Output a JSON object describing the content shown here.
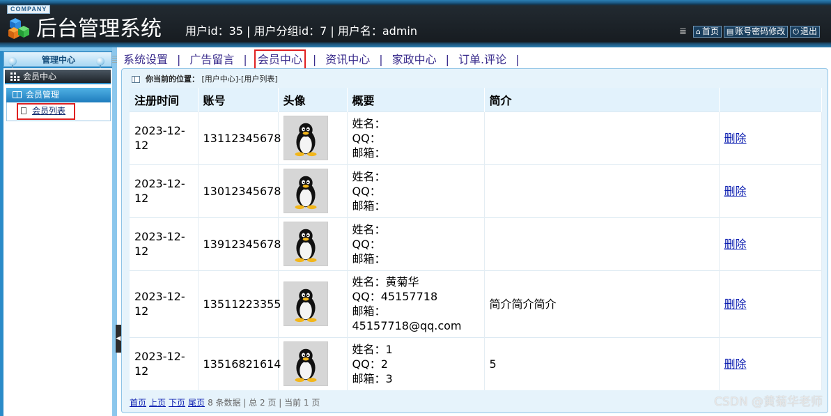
{
  "header": {
    "company": "COMPANY",
    "system_title": "后台管理系统",
    "user_info": "用户id：35 | 用户分组id：7 | 用户名：admin",
    "links": [
      {
        "icon": "home-icon",
        "label": "首页"
      },
      {
        "icon": "document-icon",
        "label": "账号密码修改"
      },
      {
        "icon": "power-icon",
        "label": "退出"
      }
    ]
  },
  "sidebar": {
    "title": "管理中心",
    "section": "会员中心",
    "group": "会员管理",
    "item": "会员列表"
  },
  "topnav": {
    "items": [
      "系统设置",
      "广告留言",
      "会员中心",
      "资讯中心",
      "家政中心",
      "订单.评论"
    ],
    "active_index": 2
  },
  "location": {
    "label": "你当前的位置：",
    "path": "[用户中心]-[用户列表]"
  },
  "table": {
    "headers": [
      "注册时间",
      "账号",
      "头像",
      "概要",
      "简介",
      ""
    ],
    "summary_labels": {
      "name": "姓名：",
      "qq": "QQ：",
      "email": "邮箱："
    },
    "delete_label": "删除",
    "rows": [
      {
        "date": "2023-12-12",
        "account": "13112345678",
        "name": "",
        "qq": "",
        "email": "",
        "intro": ""
      },
      {
        "date": "2023-12-12",
        "account": "13012345678",
        "name": "",
        "qq": "",
        "email": "",
        "intro": ""
      },
      {
        "date": "2023-12-12",
        "account": "13912345678",
        "name": "",
        "qq": "",
        "email": "",
        "intro": ""
      },
      {
        "date": "2023-12-12",
        "account": "13511223355",
        "name": "黄菊华",
        "qq": "45157718",
        "email": "45157718@qq.com",
        "intro": "简介简介简介"
      },
      {
        "date": "2023-12-12",
        "account": "13516821614",
        "name": "1",
        "qq": "2",
        "email": "3",
        "intro": "5"
      }
    ]
  },
  "pager": {
    "first": "首页",
    "prev": "上页",
    "next": "下页",
    "last": "尾页",
    "info": "8 条数据 | 总 2 页 | 当前 1 页"
  },
  "watermark": "CSDN @黄菊华老师",
  "colors": {
    "header_bg": "#1b2127",
    "accent_blue": "#2b8bc8",
    "highlight_red": "#e02020",
    "link_blue": "#0a1cb0",
    "nav_text": "#3a2c8c"
  }
}
